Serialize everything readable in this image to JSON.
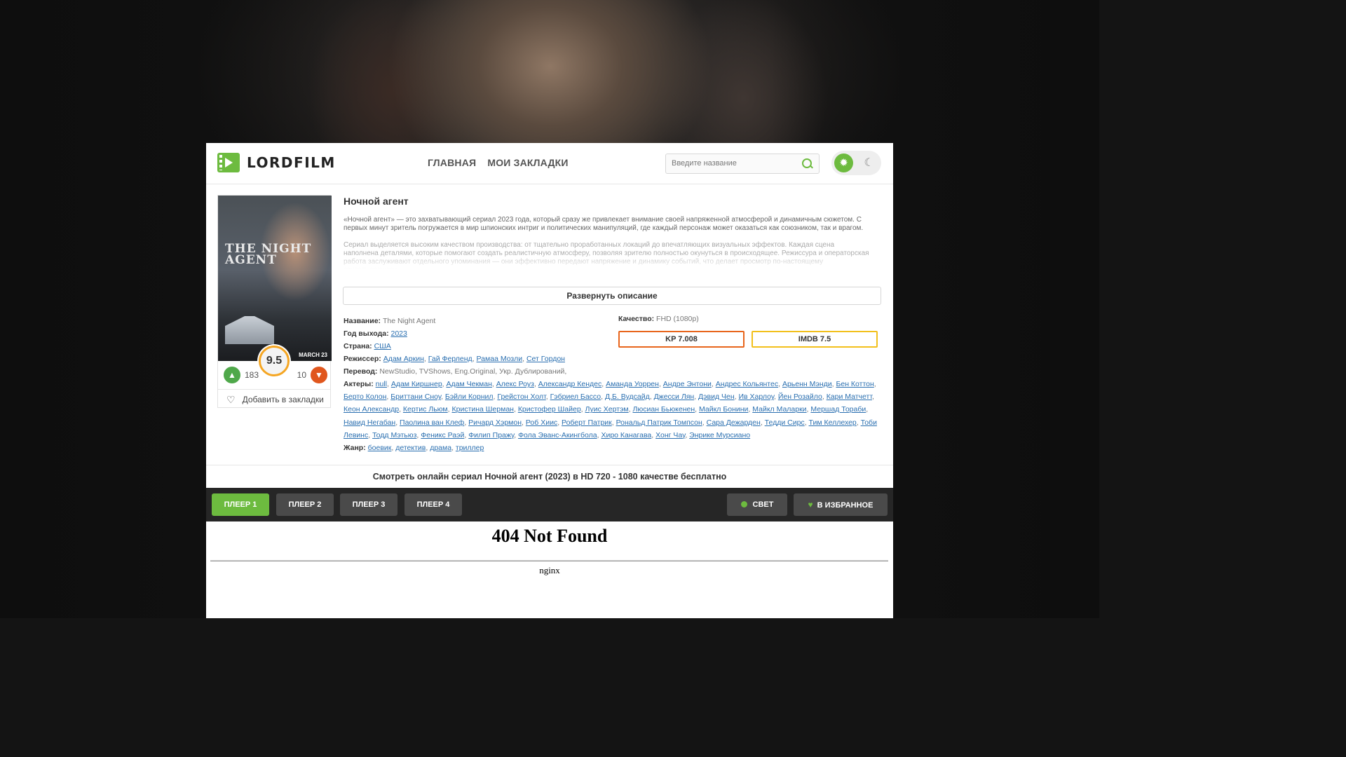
{
  "header": {
    "logo_text": "LORDFILM",
    "nav": [
      "ГЛАВНАЯ",
      "МОИ ЗАКЛАДКИ"
    ],
    "search_placeholder": "Введите название"
  },
  "poster": {
    "title_art": "THE NIGHT AGENT",
    "date_art": "MARCH 23",
    "rating": "9.5",
    "likes": "183",
    "dislikes": "10",
    "bookmark_label": "Добавить в закладки"
  },
  "movie": {
    "title": "Ночной агент",
    "desc_1": "«Ночной агент» — это захватывающий сериал 2023 года, который сразу же привлекает внимание своей напряженной атмосферой и динамичным сюжетом. С первых минут зритель погружается в мир шпионских интриг и политических манипуляций, где каждый персонаж может оказаться как союзником, так и врагом.",
    "desc_2": "Сериал выделяется высоким качеством производства: от тщательно проработанных локаций до впечатляющих визуальных эффектов. Каждая сцена наполнена деталями, которые помогают создать реалистичную атмосферу, позволяя зрителю полностью окунуться в происходящее. Режиссура и операторская работа заслуживают отдельного упоминания — они эффективно передают напряжение и динамику событий, что делает просмотр по-настоящему захватывающим.",
    "expand_label": "Развернуть описание",
    "name_label": "Название:",
    "name_value": "The Night Agent",
    "year_label": "Год выхода:",
    "year_value": "2023",
    "country_label": "Страна:",
    "country_value": "США",
    "director_label": "Режиссер:",
    "directors": [
      "Адам Аркин",
      "Гай Ферленд",
      "Рамаа Мозли",
      "Сет Гордон"
    ],
    "translation_label": "Перевод:",
    "translation_value": "NewStudio, TVShows, Eng.Original, Укр. Дублирований,",
    "actors_label": "Актеры:",
    "actors": [
      "null",
      "Адам Киршнер",
      "Адам Чекман",
      "Алекс Роуз",
      "Александр Кендес",
      "Аманда Уоррен",
      "Андре Энтони",
      "Андрес Кольянтес",
      "Арьенн Мэнди",
      "Бен Коттон",
      "Берто Колон",
      "Бриттани Сноу",
      "Бэйли Корнил",
      "Грейстон Холт",
      "Гэбриел Бассо",
      "Д.Б. Вудсайд",
      "Джесси Лян",
      "Дэвид Чен",
      "Ив Харлоу",
      "Йен Розайло",
      "Кари Матчетт",
      "Кеон Александр",
      "Кертис Льюм",
      "Кристина Шерман",
      "Кристофер Шайер",
      "Луис Хертэм",
      "Люсиан Бьюкенен",
      "Майкл Бонини",
      "Майкл Маларки",
      "Мершад Тораби",
      "Навид Негабан",
      "Паолина ван Клеф",
      "Ричард Хэрмон",
      "Роб Хиис",
      "Роберт Патрик",
      "Рональд Патрик Томпсон",
      "Сара Дежарден",
      "Тедди Сирс",
      "Тим Келлехер",
      "Тоби Левинс",
      "Тодд Мэтьюз",
      "Феникс Раэй",
      "Филип Пражу",
      "Фола Эванс-Акингбола",
      "Хиро Канагава",
      "Хонг Чау",
      "Энрике Мурсиано"
    ],
    "genre_label": "Жанр:",
    "genres": [
      "боевик",
      "детектив",
      "драма",
      "триллер"
    ],
    "quality_label": "Качество:",
    "quality_value": "FHD (1080p)",
    "kp": "KP 7.008",
    "imdb": "IMDB 7.5"
  },
  "watch_title": "Смотреть онлайн сериал Ночной агент (2023) в HD 720 - 1080 качестве бесплатно",
  "player": {
    "buttons": [
      "ПЛЕЕР 1",
      "ПЛЕЕР 2",
      "ПЛЕЕР 3",
      "ПЛЕЕР 4"
    ],
    "active_index": 0,
    "light_label": "СВЕТ",
    "favorite_label": "В ИЗБРАННОЕ"
  },
  "frame": {
    "heading": "404 Not Found",
    "server": "nginx"
  },
  "colors": {
    "accent": "#6dbb3f",
    "kp_border": "#e8651c",
    "imdb_border": "#f2c01c",
    "player_bar": "#262626"
  }
}
